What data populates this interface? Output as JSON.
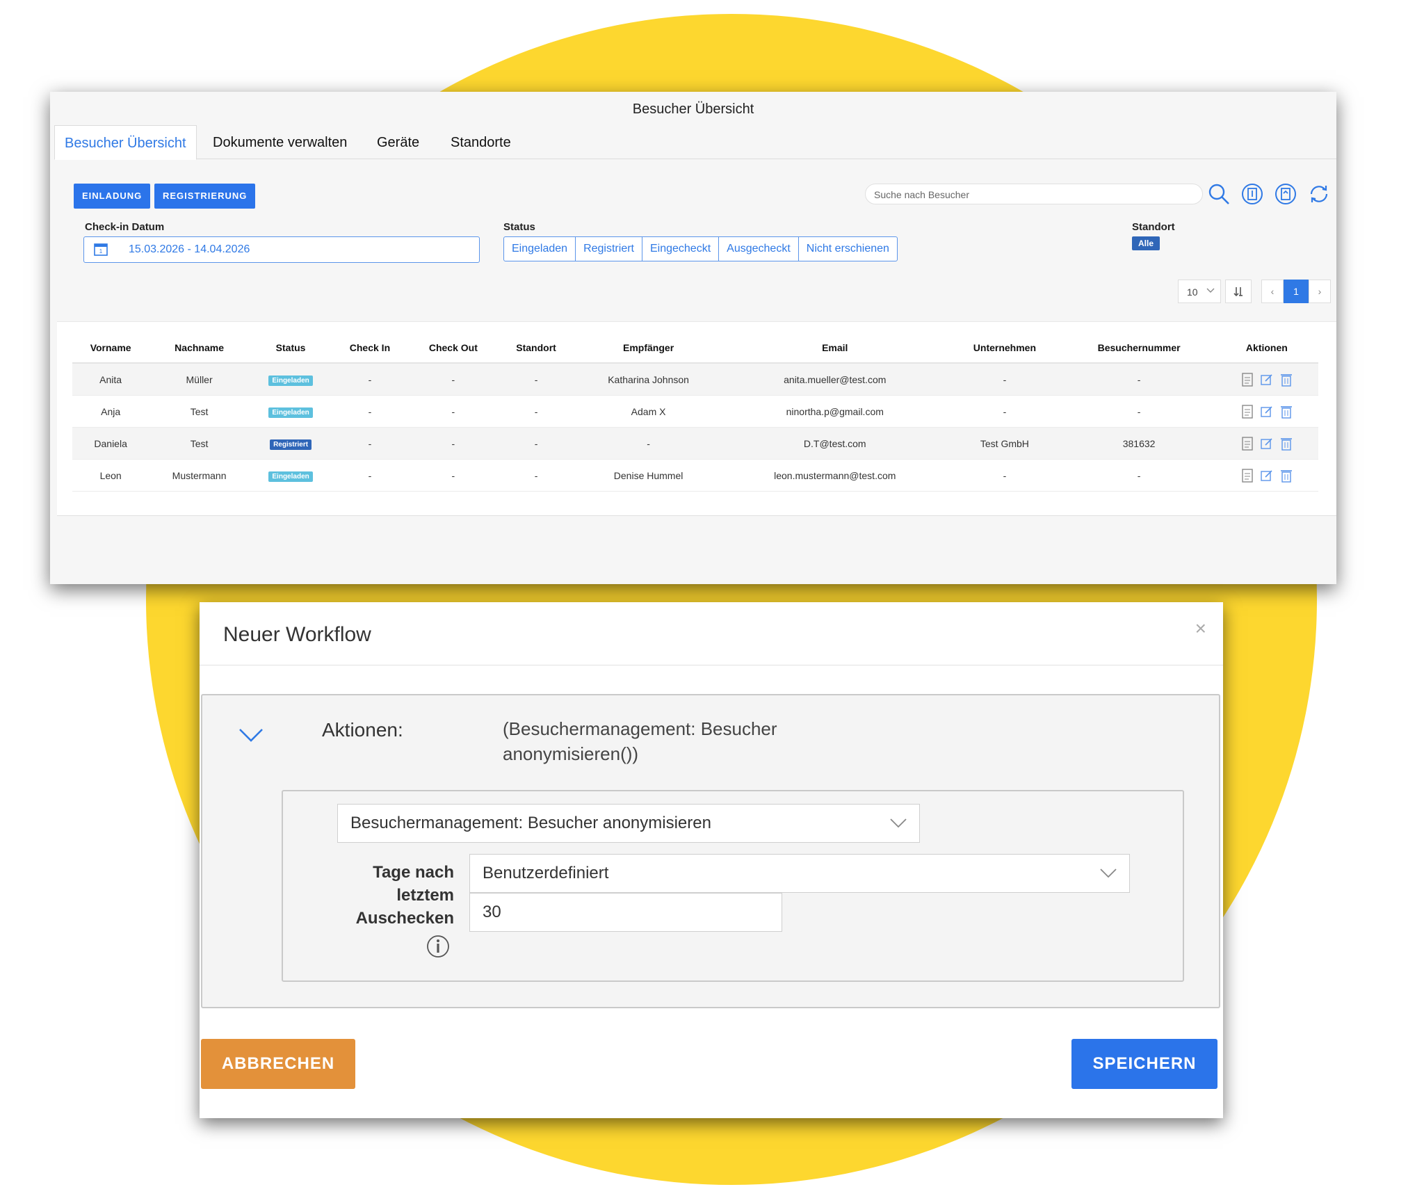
{
  "app": {
    "window_title": "Besucher Übersicht"
  },
  "tabs": [
    {
      "label": "Besucher Übersicht",
      "active": true
    },
    {
      "label": "Dokumente verwalten"
    },
    {
      "label": "Geräte"
    },
    {
      "label": "Standorte"
    }
  ],
  "toolbar": {
    "einladung": "EINLADUNG",
    "registrierung": "REGISTRIERUNG",
    "search_placeholder": "Suche nach Besucher"
  },
  "filters": {
    "checkin_label": "Check-in Datum",
    "date_range": "15.03.2026 - 14.04.2026",
    "status_label": "Status",
    "status_options": [
      "Eingeladen",
      "Registriert",
      "Eingecheckt",
      "Ausgecheckt",
      "Nicht erschienen"
    ],
    "standort_label": "Standort",
    "standort_value": "Alle"
  },
  "pager": {
    "page_size": "10",
    "prev": "‹",
    "current": "1",
    "next": "›"
  },
  "table": {
    "headers": [
      "Vorname",
      "Nachname",
      "Status",
      "Check In",
      "Check Out",
      "Standort",
      "Empfänger",
      "Email",
      "Unternehmen",
      "Besuchernummer",
      "Aktionen"
    ],
    "rows": [
      [
        "Anita",
        "Müller",
        "Eingeladen",
        "-",
        "-",
        "-",
        "Katharina Johnson",
        "anita.mueller@test.com",
        "-",
        "-"
      ],
      [
        "Anja",
        "Test",
        "Eingeladen",
        "-",
        "-",
        "-",
        "Adam X",
        "ninortha.p@gmail.com",
        "-",
        "-"
      ],
      [
        "Daniela",
        "Test",
        "Registriert",
        "-",
        "-",
        "-",
        "-",
        "D.T@test.com",
        "Test GmbH",
        "381632"
      ],
      [
        "Leon",
        "Mustermann",
        "Eingeladen",
        "-",
        "-",
        "-",
        "Denise Hummel",
        "leon.mustermann@test.com",
        "-",
        "-"
      ]
    ]
  },
  "dialog": {
    "title": "Neuer Workflow",
    "close": "×",
    "aktionen_label": "Aktionen:",
    "aktionen_desc": "(Besuchermanagement: Besucher anonymisieren())",
    "action_select": "Besuchermanagement: Besucher anonymisieren",
    "tage_label": "Tage nach letztem Auschecken",
    "tage_select": "Benutzerdefiniert",
    "tage_value": "30",
    "cancel": "ABBRECHEN",
    "save": "SPEICHERN"
  },
  "colors": {
    "accent": "#2b74ea",
    "cancel": "#e3913a",
    "background_circle": "#fdd72f"
  }
}
